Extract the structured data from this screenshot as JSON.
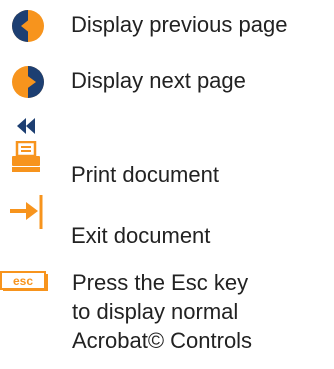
{
  "colors": {
    "accent": "#f7941d",
    "dark": "#1d3f72",
    "text": "#222222"
  },
  "items": [
    {
      "icon": "previous-page-icon",
      "label": "Display previous page"
    },
    {
      "icon": "next-page-icon",
      "label": "Display next page"
    },
    {
      "icon": "first-page-icon",
      "label": ""
    },
    {
      "icon": "print-icon",
      "label": "Print document"
    },
    {
      "icon": "exit-icon",
      "label": "Exit document"
    },
    {
      "icon": "esc-key-icon",
      "key_label": "esc",
      "label_lines": [
        "Press the Esc key",
        "to display normal",
        "Acrobat© Controls"
      ]
    }
  ]
}
